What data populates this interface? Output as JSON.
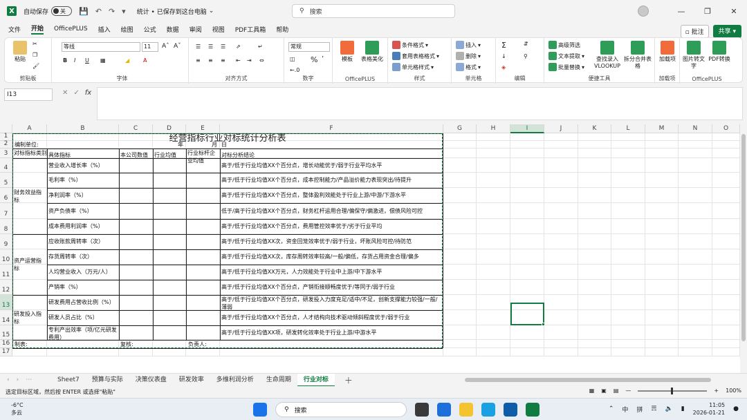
{
  "titlebar": {
    "autosave_label": "自动保存",
    "autosave_state": "关",
    "doc_title": "统计 • 已保存到这台电脑",
    "search_placeholder": "搜索"
  },
  "menu": {
    "tabs": [
      "文件",
      "开始",
      "OfficePLUS",
      "插入",
      "绘图",
      "公式",
      "数据",
      "审阅",
      "视图",
      "PDF工具箱",
      "帮助"
    ],
    "active": "开始",
    "comment": "批注",
    "share": "共享"
  },
  "ribbon": {
    "clipboard": {
      "paste": "粘贴",
      "label": "剪贴板"
    },
    "font": {
      "name": "等线",
      "size": "11",
      "label": "字体"
    },
    "align": {
      "label": "对齐方式"
    },
    "number": {
      "format": "常规",
      "label": "数字"
    },
    "officeplus1": {
      "template": "模板",
      "beautify": "表格美化",
      "label": "OfficePLUS"
    },
    "styles": {
      "cond": "条件格式",
      "table": "套用表格格式",
      "cell": "单元格样式",
      "label": "样式"
    },
    "cells": {
      "insert": "插入",
      "delete": "删除",
      "format": "格式",
      "label": "单元格"
    },
    "edit": {
      "label": "编辑"
    },
    "tools": {
      "filter": "高级筛选",
      "text": "文本提取",
      "batch": "批量替换",
      "vlookup": "查找录入 VLOOKUP",
      "split": "拆分合并表格",
      "label": "便捷工具"
    },
    "addin": {
      "btn": "加载项",
      "label": "加载项"
    },
    "officeplus2": {
      "picture": "图片转文字",
      "pdf": "PDF转换",
      "label": "OfficePLUS"
    }
  },
  "formula_bar": {
    "name_box": "I13",
    "fx": "fx",
    "value": ""
  },
  "columns": [
    "A",
    "B",
    "C",
    "D",
    "E",
    "F",
    "G",
    "H",
    "I",
    "J",
    "K",
    "L",
    "M",
    "N",
    "O"
  ],
  "rows": [
    "1",
    "2",
    "3",
    "4",
    "5",
    "6",
    "7",
    "8",
    "9",
    "10",
    "11",
    "12",
    "13",
    "14",
    "15",
    "16",
    "17"
  ],
  "sheet": {
    "title": "经营指标行业对标统计分析表",
    "unit_label": "编制单位:",
    "year_label": "年",
    "month_label": "月",
    "day_label": "日",
    "headers": {
      "category": "对标指标类别",
      "indicator": "具体指标",
      "company": "本公司数值",
      "industry": "行业均值",
      "benchmark": "行业标杆企业均值",
      "conclusion": "对标分析结论"
    },
    "categories": [
      "财务效益指标",
      "资产运营指标",
      "研发投入指标"
    ],
    "items": [
      {
        "indicator": "营业收入增长率（%）",
        "conclusion": "高于/低于行业均值XX个百分点，增长动能优于/弱于行业平均水平"
      },
      {
        "indicator": "毛利率（%）",
        "conclusion": "高于/低于行业均值XX个百分点，成本控制能力/产品溢价能力表现突出/待提升"
      },
      {
        "indicator": "净利润率（%）",
        "conclusion": "高于/低于行业均值XX个百分点，整体盈利效能处于行业上游/中游/下游水平"
      },
      {
        "indicator": "资产负债率（%）",
        "conclusion": "低于/高于行业均值XX个百分点，财务杠杆运用合理/偏保守/偏激进，偿债风险可控"
      },
      {
        "indicator": "成本费用利润率（%）",
        "conclusion": "高于/低于行业均值XX个百分点，费用管控效率优于/劣于行业平均"
      },
      {
        "indicator": "应收账款周转率（次）",
        "conclusion": "高于/低于行业均值XX次，资金回笼效率优于/弱于行业，坏账风险可控/待防范"
      },
      {
        "indicator": "存货周转率（次）",
        "conclusion": "高于/低于行业均值XX次，库存周转效率较高/一般/偏低，存货占用资金合理/偏多"
      },
      {
        "indicator": "人均营业收入（万元/人）",
        "conclusion": "高于/低于行业均值XX万元，人力效能处于行业中上游/中下游水平"
      },
      {
        "indicator": "产销率（%）",
        "conclusion": "高于/低于行业均值XX个百分点，产销衔接顺畅度优于/等同于/弱于行业"
      },
      {
        "indicator": "研发费用占营收比例（%）",
        "conclusion": "高于/低于行业均值XX个百分点，研发投入力度充足/适中/不足，创新支撑能力较强/一般/薄弱"
      },
      {
        "indicator": "研发人员占比（%）",
        "conclusion": "高于/低于行业均值XX个百分点，人才结构向技术驱动倾斜程度优于/弱于行业"
      },
      {
        "indicator": "专利产出效率（项/亿元研发费用）",
        "conclusion": "高于/低于行业均值XX项，研发转化效率处于行业上游/中游水平"
      }
    ],
    "footer": {
      "maker": "制表:",
      "reviewer": "复核:",
      "owner": "负责人:"
    }
  },
  "sheet_tabs": [
    "Sheet7",
    "预算与实际",
    "决策仪表盘",
    "研发效率",
    "多维利润分析",
    "生命周期",
    "行业对标"
  ],
  "active_sheet": "行业对标",
  "status": {
    "message": "选定目标区域，然后按 ENTER 或选择\"粘贴\"",
    "zoom": "100%"
  },
  "taskbar": {
    "temp": "-6°C",
    "weather": "多云",
    "search": "搜索",
    "ime1": "中",
    "ime2": "拼",
    "time": "11:05",
    "date": "2026-01-21"
  },
  "colors": {
    "accent": "#107c41",
    "share": "#107c41"
  }
}
